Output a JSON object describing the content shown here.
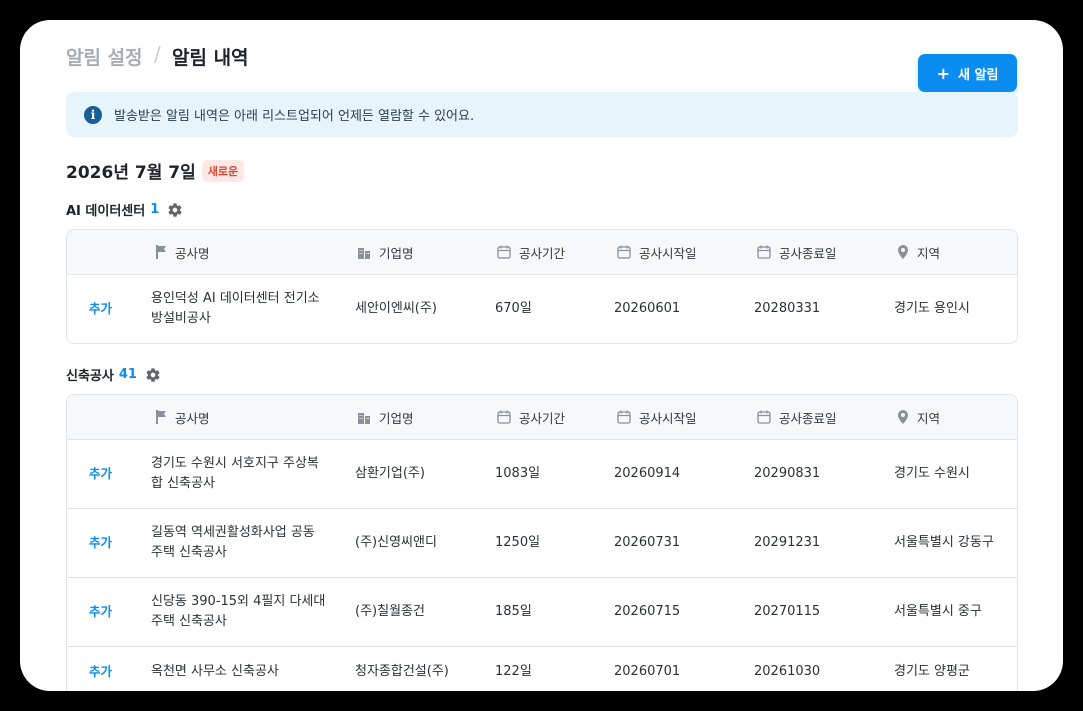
{
  "header": {
    "breadcrumb_parent": "알림 설정",
    "breadcrumb_sep": "/",
    "breadcrumb_current": "알림 내역",
    "new_button_icon": "+",
    "new_button_label": "새 알림"
  },
  "info_banner": {
    "icon": "i",
    "text": "발송받은 알림 내역은 아래 리스트업되어 언제든 열람할 수 있어요."
  },
  "date_group": {
    "date": "2026년 7월 7일",
    "badge": "새로운"
  },
  "columns": {
    "name": "공사명",
    "company": "기업명",
    "period": "공사기간",
    "start": "공사시작일",
    "end": "공사종료일",
    "region": "지역"
  },
  "sections": [
    {
      "title": "AI 데이터센터",
      "count": "1",
      "rows": [
        {
          "action": "추가",
          "name": "용인덕성 AI 데이터센터 전기소방설비공사",
          "company": "세안이엔씨(주)",
          "period": "670일",
          "start": "20260601",
          "end": "20280331",
          "region": "경기도 용인시"
        }
      ]
    },
    {
      "title": "신축공사",
      "count": "41",
      "rows": [
        {
          "action": "추가",
          "name": "경기도 수원시 서호지구 주상복합 신축공사",
          "company": "삼환기업(주)",
          "period": "1083일",
          "start": "20260914",
          "end": "20290831",
          "region": "경기도 수원시"
        },
        {
          "action": "추가",
          "name": "길동역 역세권활성화사업 공동주택 신축공사",
          "company": "(주)신영씨앤디",
          "period": "1250일",
          "start": "20260731",
          "end": "20291231",
          "region": "서울특별시 강동구"
        },
        {
          "action": "추가",
          "name": "신당동 390-15외 4필지 다세대주택 신축공사",
          "company": "(주)칠월종건",
          "period": "185일",
          "start": "20260715",
          "end": "20270115",
          "region": "서울특별시 중구"
        },
        {
          "action": "추가",
          "name": "옥천면 사무소 신축공사",
          "company": "청자종합건설(주)",
          "period": "122일",
          "start": "20260701",
          "end": "20261030",
          "region": "경기도 양평군"
        }
      ]
    }
  ]
}
